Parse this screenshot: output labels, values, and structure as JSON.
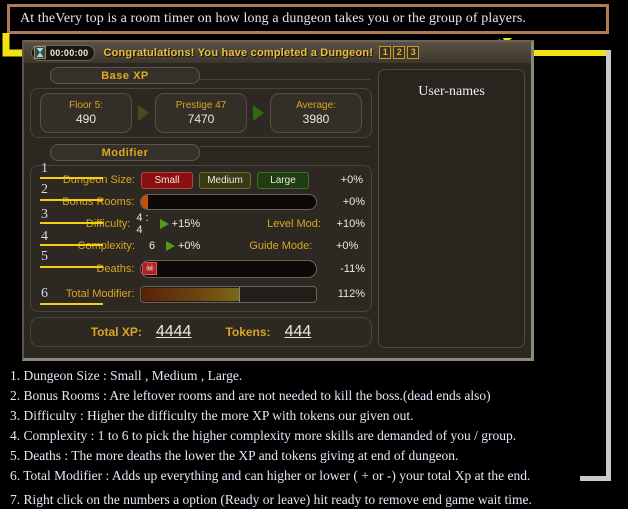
{
  "caption": {
    "text": "At theVery top is a room timer on how long a dungeon takes you or the group of players."
  },
  "window": {
    "timer": "00:00:00",
    "timer_icon": "hourglass-icon",
    "congrats": "Congratulations! You have completed a Dungeon!",
    "player_buttons": [
      "1",
      "2",
      "3"
    ],
    "user_panel_label": "User-names"
  },
  "base_xp": {
    "header": "Base XP",
    "cells": [
      {
        "title": "Floor 5:",
        "value": "490"
      },
      {
        "title": "Prestige 47",
        "value": "7470"
      },
      {
        "title": "Average:",
        "value": "3980"
      }
    ]
  },
  "modifier": {
    "header": "Modifier",
    "rows": [
      {
        "num": "1",
        "label": "Dungeon Size:",
        "options": [
          "Small",
          "Medium",
          "Large"
        ],
        "selected": "Small",
        "pct": "+0%"
      },
      {
        "num": "2",
        "label": "Bonus Rooms:",
        "pct": "+0%"
      },
      {
        "num": "3",
        "label": "Difficulty:",
        "value": "4 : 4",
        "pct": "+15%",
        "right_label": "Level Mod:",
        "right_pct": "+10%"
      },
      {
        "num": "4",
        "label": "Complexity:",
        "value": "6",
        "pct": "+0%",
        "right_label": "Guide Mode:",
        "right_pct": "+0%"
      },
      {
        "num": "5",
        "label": "Deaths:",
        "icon": "skull-icon",
        "pct": "-11%"
      },
      {
        "num": "6",
        "label": "Total Modifier:",
        "pct": "112%"
      }
    ]
  },
  "totals": {
    "xp_label": "Total XP:",
    "xp_value": "4444",
    "tokens_label": "Tokens:",
    "tokens_value": "444"
  },
  "notes": [
    "1. Dungeon Size : Small , Medium , Large.",
    "2. Bonus Rooms : Are leftover rooms and are not needed to kill the boss.(dead ends also)",
    "3. Difficulty : Higher the difficulty the more XP with tokens our given out.",
    "4. Complexity : 1 to 6 to pick the higher complexity more skills are demanded of you / group.",
    "5. Deaths : The more deaths the lower the XP and tokens giving at end of dungeon.",
    "6. Total Modifier : Adds up everything and can higher or lower ( + or -) your total Xp at the end.",
    "7. Right click on the numbers a option (Ready or leave) hit ready to remove end game wait time."
  ],
  "colors": {
    "caption_border": "#b07a54",
    "arrow_yellow": "#f2e313",
    "gold_text": "#e0a81f",
    "small_red": "#8a1010",
    "medium_olive": "#3b3a17",
    "large_green": "#1f3d13",
    "connector_gray": "#c9c9c9"
  }
}
